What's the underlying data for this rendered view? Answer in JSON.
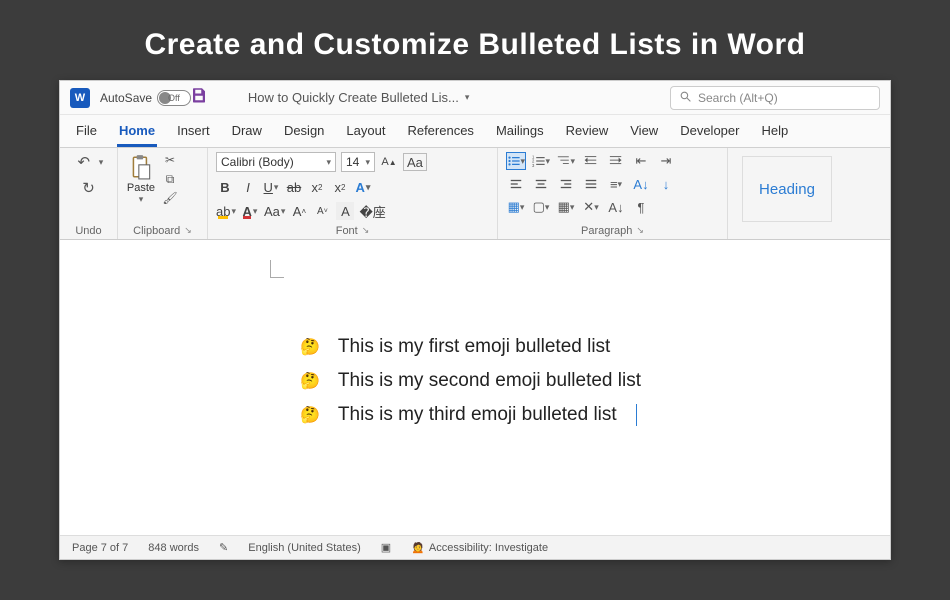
{
  "slide_title": "Create and Customize Bulleted Lists in Word",
  "titlebar": {
    "autosave_label": "AutoSave",
    "autosave_state": "Off",
    "doc_title": "How to Quickly Create Bulleted Lis...",
    "search_placeholder": "Search (Alt+Q)"
  },
  "tabs": [
    "File",
    "Home",
    "Insert",
    "Draw",
    "Design",
    "Layout",
    "References",
    "Mailings",
    "Review",
    "View",
    "Developer",
    "Help"
  ],
  "active_tab": "Home",
  "ribbon": {
    "undo_label": "Undo",
    "clipboard_label": "Clipboard",
    "paste_label": "Paste",
    "font_label": "Font",
    "font_name": "Calibri (Body)",
    "font_size": "14",
    "paragraph_label": "Paragraph",
    "heading_style": "Heading"
  },
  "document": {
    "bullet_emoji": "🤔",
    "items": [
      "This is my first emoji bulleted list",
      "This is my second emoji bulleted list",
      "This is my third emoji bulleted list"
    ]
  },
  "statusbar": {
    "page": "Page 7 of 7",
    "words": "848 words",
    "lang": "English (United States)",
    "accessibility": "Accessibility: Investigate"
  }
}
